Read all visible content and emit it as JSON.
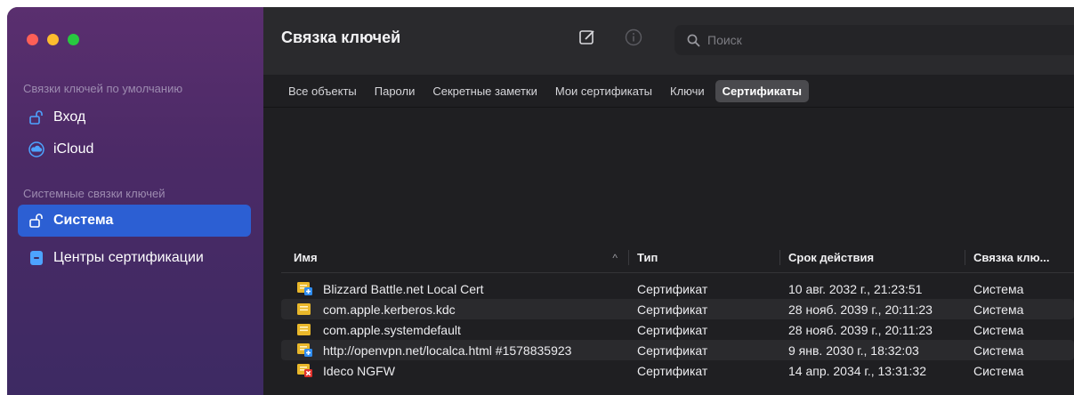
{
  "window": {
    "title": "Связка ключей",
    "traffic_colors": [
      "#fe5f57",
      "#febc2e",
      "#28c840"
    ]
  },
  "sidebar": {
    "default_section": "Связки ключей по умолчанию",
    "default_items": [
      {
        "label": "Вход",
        "icon": "lock-icon"
      },
      {
        "label": "iCloud",
        "icon": "cloud-icon"
      }
    ],
    "system_section": "Системные связки ключей",
    "system_items": [
      {
        "label": "Система",
        "icon": "lock-icon",
        "selected": true
      },
      {
        "label": "Центры сертификации",
        "icon": "cabinet-icon"
      }
    ]
  },
  "toolbar": {
    "compose_icon": "compose-icon",
    "info_icon": "info-icon",
    "search_placeholder": "Поиск"
  },
  "tabs": [
    "Все объекты",
    "Пароли",
    "Секретные заметки",
    "Мои сертификаты",
    "Ключи",
    "Сертификаты"
  ],
  "active_tab": "Сертификаты",
  "table": {
    "columns": [
      "Имя",
      "Тип",
      "Срок действия",
      "Связка клю..."
    ],
    "sort_indicator": "^",
    "rows": [
      {
        "name": "Blizzard Battle.net Local Cert",
        "type": "Сертификат",
        "expires": "10 авг. 2032 г., 21:23:51",
        "keychain": "Система",
        "badge": "plus"
      },
      {
        "name": "com.apple.kerberos.kdc",
        "type": "Сертификат",
        "expires": "28 нояб. 2039 г., 20:11:23",
        "keychain": "Система",
        "badge": "none"
      },
      {
        "name": "com.apple.systemdefault",
        "type": "Сертификат",
        "expires": "28 нояб. 2039 г., 20:11:23",
        "keychain": "Система",
        "badge": "none"
      },
      {
        "name": "http://openvpn.net/localca.html #1578835923",
        "type": "Сертификат",
        "expires": "9 янв. 2030 г., 18:32:03",
        "keychain": "Система",
        "badge": "plus"
      },
      {
        "name": "Ideco NGFW",
        "type": "Сертификат",
        "expires": "14 апр. 2034 г., 13:31:32",
        "keychain": "Система",
        "badge": "x"
      }
    ]
  },
  "colors": {
    "accent": "#2c5fd3",
    "cert_gold": "#e9b72a",
    "badge_blue": "#2f8df0",
    "badge_red": "#e0302a"
  }
}
